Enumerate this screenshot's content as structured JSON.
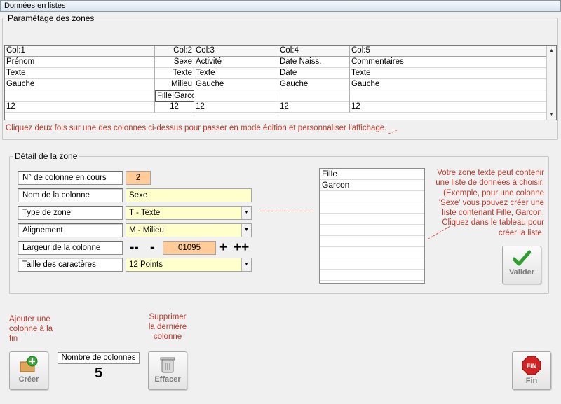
{
  "window": {
    "title": "Données en listes"
  },
  "zones_group": {
    "label": "Paramètage des zones"
  },
  "grid": {
    "headers": [
      "Col:1",
      "Col:2",
      "Col:3",
      "Col:4",
      "Col:5"
    ],
    "rows": [
      [
        "Prénom",
        "Sexe",
        "Activité",
        "Date Naiss.",
        "Commentaires"
      ],
      [
        "Texte",
        "Texte",
        "Texte",
        "Date",
        "Texte"
      ],
      [
        "Gauche",
        "Milieu",
        "Gauche",
        "Gauche",
        "Gauche"
      ],
      [
        "",
        "Fille|Garcon",
        "",
        "",
        ""
      ],
      [
        "12",
        "12",
        "12",
        "12",
        "12"
      ]
    ]
  },
  "grid_hint": "Cliquez deux fois sur une des colonnes ci-dessus pour passer en mode édition et personnaliser l'affichage.",
  "detail_group": {
    "label": "Détail de la zone"
  },
  "detail": {
    "col_num_label": "N° de colonne en cours",
    "col_num_value": "2",
    "col_name_label": "Nom de la colonne",
    "col_name_value": "Sexe",
    "type_label": "Type de zone",
    "type_value": "T - Texte",
    "align_label": "Alignement",
    "align_value": "M - Milieu",
    "width_label": "Largeur de la colonne",
    "width_value": "01095",
    "step_minus2": "--",
    "step_minus1": "-",
    "step_plus1": "+",
    "step_plus2": "++",
    "font_label": "Taille des caractères",
    "font_value": "12 Points"
  },
  "list_values": [
    "Fille",
    "Garcon",
    "",
    "",
    "",
    "",
    "",
    "",
    "",
    ""
  ],
  "list_help": "Votre zone texte peut contenir une liste de données à choisir. (Exemple, pour une colonne 'Sexe' vous pouvez créer une liste contenant Fille, Garcon. Cliquez dans le tableau pour créer la liste.",
  "buttons": {
    "validate": "Valider",
    "create": "Créer",
    "delete": "Effacer",
    "finish": "Fin",
    "finish_icon_text": "FIN"
  },
  "bottom": {
    "add_hint": "Ajouter une colonne à la fin",
    "delete_hint": "Supprimer la dernière colonne",
    "count_label": "Nombre de colonnes",
    "count_value": "5"
  },
  "colors": {
    "accent_red": "#c0392b",
    "field_yellow": "#ffffcc",
    "field_orange": "#ffcc99",
    "check_green": "#2e9e2e"
  }
}
